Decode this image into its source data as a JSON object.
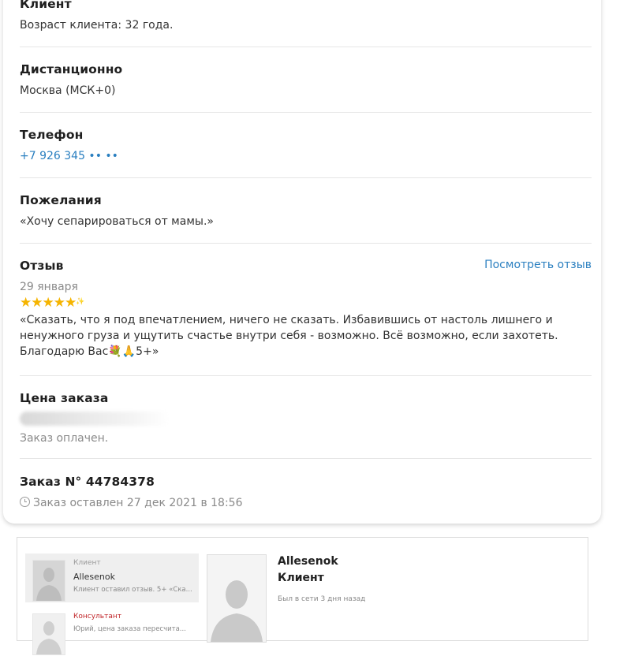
{
  "client": {
    "heading": "Клиент",
    "age": "Возраст клиента: 32 года."
  },
  "format": {
    "heading": "Дистанционно",
    "timezone": "Москва (МСК+0)"
  },
  "phone": {
    "heading": "Телефон",
    "value": "+7 926 345 •• ••"
  },
  "wishes": {
    "heading": "Пожелания",
    "text": "«Хочу сепарироваться от мамы.»"
  },
  "review": {
    "heading": "Отзыв",
    "view_link": "Посмотреть отзыв",
    "date": "29 января",
    "stars": "★★★★★",
    "sparkle": "✨",
    "rating_value": 5,
    "text_line1": "«Сказать, что я под впечатлением, ничего не сказать. Избавившись от настоль лишнего и",
    "text_line2": "ненужного груза и ущутить счастье внутри себя - возможно. Всё возможно, если захотеть.",
    "text_line3": "Благодарю Вас💐🙏5+»"
  },
  "price": {
    "heading": "Цена заказа",
    "status": "Заказ оплачен."
  },
  "order": {
    "heading": "Заказ N° 44784378",
    "created": "Заказ оставлен 27 дек 2021 в 18:56"
  },
  "chat": {
    "dialogs": [
      {
        "role": "Клиент",
        "name": "Allesenok",
        "snippet": "Клиент оставил отзыв. 5+ «Ска..."
      },
      {
        "role": "Консультант",
        "name": "",
        "snippet": "Юрий, цена заказа пересчита..."
      }
    ],
    "profile": {
      "name": "Allesenok",
      "role": "Клиент",
      "status": "Был в сети 3 дня назад"
    }
  },
  "colors": {
    "link": "#2a7fc0",
    "star": "#f5b400",
    "consultant_role": "#c0262a"
  }
}
